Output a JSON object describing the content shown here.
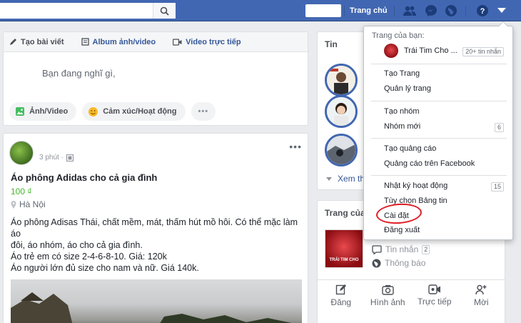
{
  "topbar": {
    "search_icon": "search-icon",
    "home_label": "Trang chủ",
    "icons": [
      "friends-icon",
      "messenger-icon",
      "globe-icon",
      "help-icon",
      "caret-down-icon"
    ]
  },
  "composer": {
    "tabs": [
      {
        "label": "Tạo bài viết",
        "icon": "pencil-icon"
      },
      {
        "label": "Album ảnh/video",
        "icon": "album-icon"
      },
      {
        "label": "Video trực tiếp",
        "icon": "video-icon"
      }
    ],
    "placeholder": "Bạn đang nghĩ gì,",
    "actions": [
      {
        "label": "Ảnh/Video",
        "icon": "photo-icon"
      },
      {
        "label": "Cảm xúc/Hoạt động",
        "icon": "emoji-icon"
      },
      {
        "label": "•••",
        "icon": "more-icon"
      }
    ]
  },
  "post": {
    "time": "3 phút ·",
    "title": "Áo phông Adidas cho cả gia đình",
    "price": "100 ₫",
    "location": "Hà Nội",
    "body_lines": [
      "Áo phông Adisas Thái, chất mềm, mát, thấm hút mồ hôi. Có thể mặc làm áo",
      "đôi, áo nhóm, áo cho cả gia đình.",
      "Áo trẻ em có size 2-4-6-8-10. Giá: 120k",
      "Áo người lớn đủ size cho nam và nữ. Giá 140k."
    ],
    "more": "•••"
  },
  "stories": {
    "title": "Tin",
    "see_more": "Xem th"
  },
  "page_card": {
    "title": "Trang của",
    "thumb_text": "TRÁI TIM CHO",
    "rows": [
      {
        "label": "Tin nhắn",
        "count": "2",
        "icon": "message-icon"
      },
      {
        "label": "Thông báo",
        "count": "",
        "icon": "globe-icon"
      }
    ],
    "actions": [
      {
        "label": "Đăng",
        "icon": "edit-icon"
      },
      {
        "label": "Hình ảnh",
        "icon": "camera-icon"
      },
      {
        "label": "Trực tiếp",
        "icon": "live-icon"
      },
      {
        "label": "Mời",
        "icon": "invite-icon"
      }
    ]
  },
  "dropdown": {
    "header": "Trang của bạn:",
    "page_name": "Trái Tim Cho ...",
    "page_badge": "20+ tin nhắn",
    "items": [
      {
        "label": "Tạo Trang",
        "badge": ""
      },
      {
        "label": "Quản lý trang",
        "badge": ""
      },
      {
        "label": "Tạo nhóm",
        "badge": ""
      },
      {
        "label": "Nhóm mới",
        "badge": "6"
      },
      {
        "label": "Tạo quảng cáo",
        "badge": ""
      },
      {
        "label": "Quảng cáo trên Facebook",
        "badge": ""
      },
      {
        "label": "Nhật ký hoạt động",
        "badge": "15"
      },
      {
        "label": "Tùy chọn Bảng tin",
        "badge": ""
      },
      {
        "label": "Cài đặt",
        "badge": ""
      },
      {
        "label": "Đăng xuất",
        "badge": ""
      }
    ],
    "highlight_color": "#e01b24"
  },
  "colors": {
    "brand": "#4267b2",
    "link": "#365899",
    "price": "#42b72a"
  }
}
